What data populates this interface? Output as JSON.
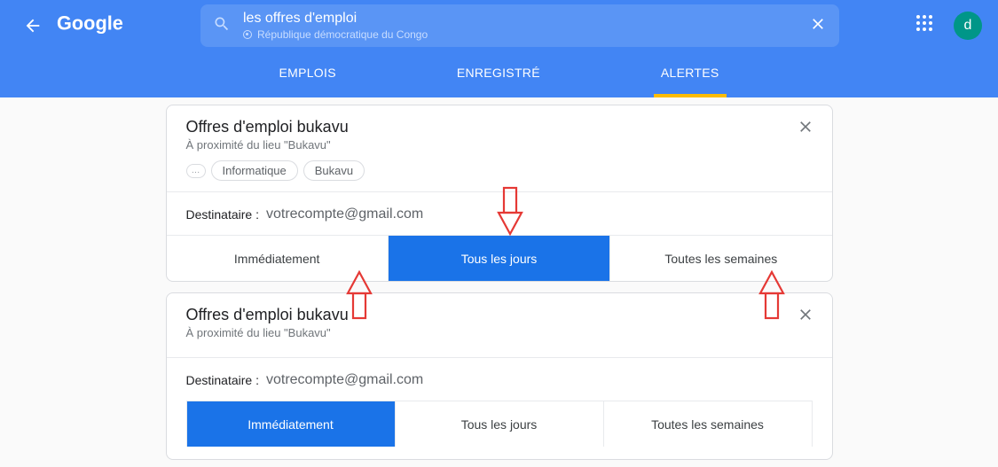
{
  "header": {
    "logo_text": "Google",
    "search_query": "les offres d'emploi",
    "location": "République démocratique du Congo",
    "avatar_letter": "d"
  },
  "tabs": {
    "emplois": "EMPLOIS",
    "enregistre": "ENREGISTRÉ",
    "alertes": "ALERTES"
  },
  "alerts": [
    {
      "title": "Offres d'emploi bukavu",
      "subtitle": "À proximité du lieu \"Bukavu\"",
      "chips": [
        "Informatique",
        "Bukavu"
      ],
      "recipient_label": "Destinataire :",
      "recipient_value": "votrecompte@gmail.com",
      "freq": {
        "immediate": "Immédiatement",
        "daily": "Tous les jours",
        "weekly": "Toutes les semaines",
        "selected": "daily"
      }
    },
    {
      "title": "Offres d'emploi bukavu",
      "subtitle": "À proximité du lieu \"Bukavu\"",
      "recipient_label": "Destinataire :",
      "recipient_value": "votrecompte@gmail.com",
      "freq": {
        "immediate": "Immédiatement",
        "daily": "Tous les jours",
        "weekly": "Toutes les semaines",
        "selected": "immediate"
      }
    }
  ]
}
